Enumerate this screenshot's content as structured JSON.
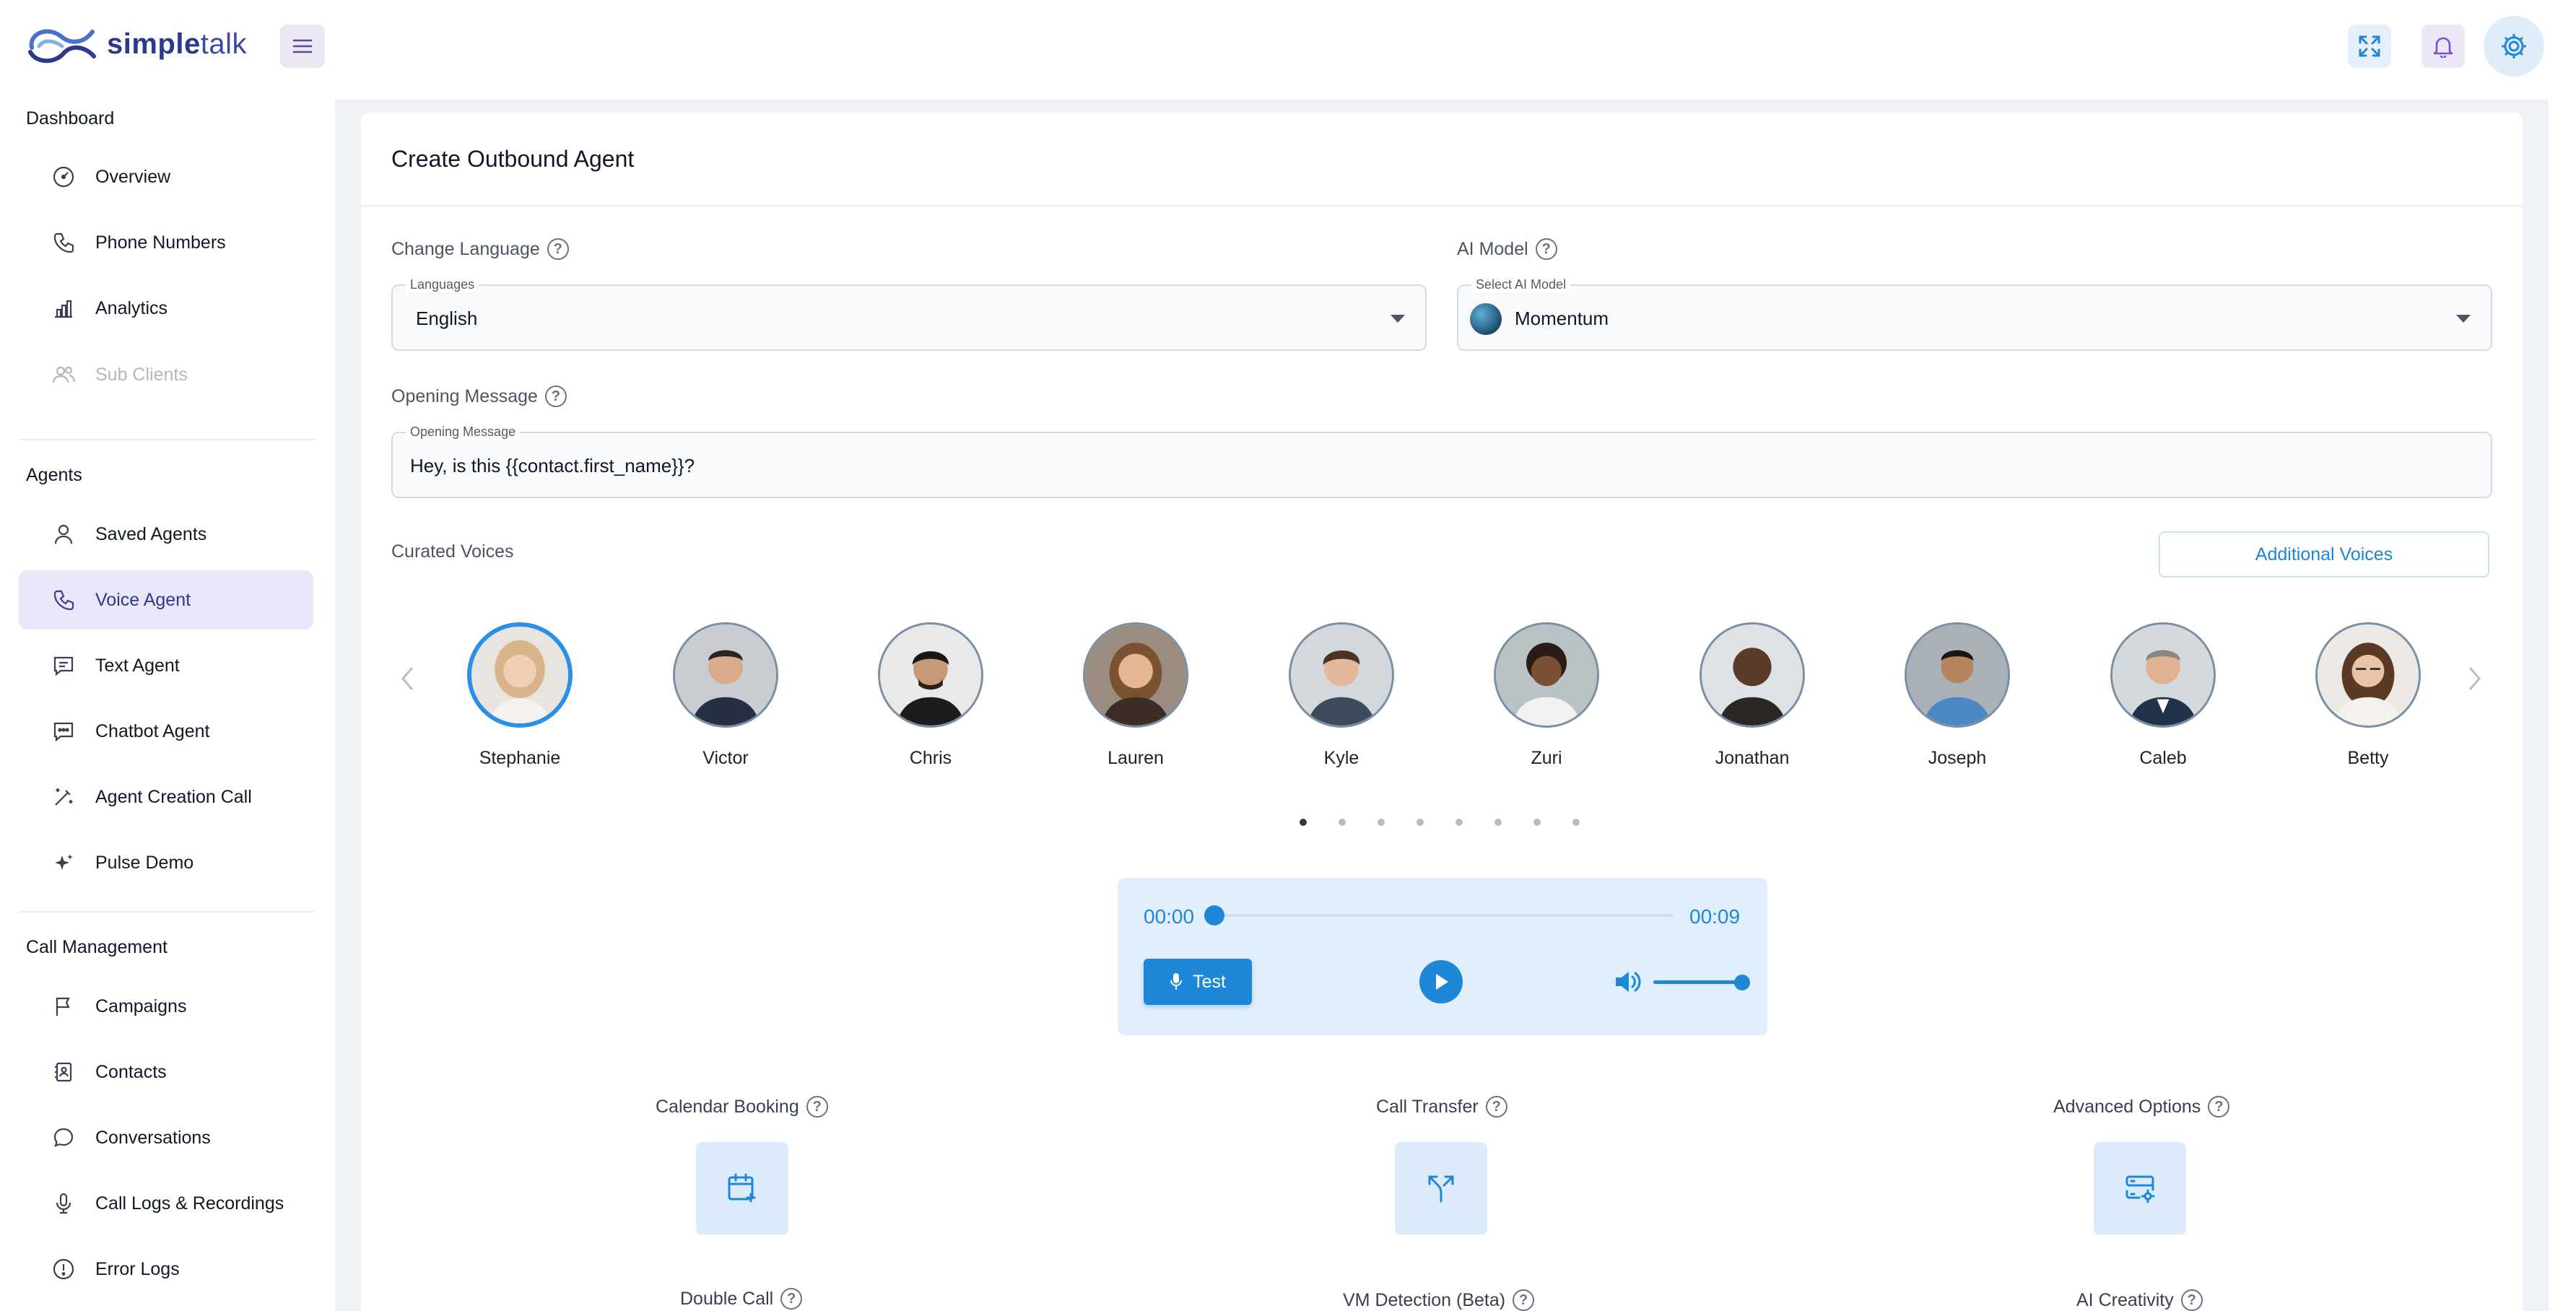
{
  "brand": {
    "name_bold": "simple",
    "name_light": "talk"
  },
  "topbar": {
    "menu_icon": "hamburger-icon",
    "fullscreen_icon": "expand-icon",
    "notifications_icon": "bell-icon",
    "settings_icon": "gear-icon"
  },
  "sidebar": {
    "sections": [
      {
        "title": "Dashboard",
        "items": [
          {
            "label": "Overview",
            "icon": "gauge-icon"
          },
          {
            "label": "Phone Numbers",
            "icon": "phone-icon"
          },
          {
            "label": "Analytics",
            "icon": "bar-chart-icon"
          },
          {
            "label": "Sub Clients",
            "icon": "users-icon",
            "disabled": true
          }
        ]
      },
      {
        "title": "Agents",
        "items": [
          {
            "label": "Saved Agents",
            "icon": "user-icon"
          },
          {
            "label": "Voice Agent",
            "icon": "phone-icon",
            "active": true
          },
          {
            "label": "Text Agent",
            "icon": "message-square-icon"
          },
          {
            "label": "Chatbot Agent",
            "icon": "chat-bubble-icon"
          },
          {
            "label": "Agent Creation Call",
            "icon": "magic-wand-icon"
          },
          {
            "label": "Pulse Demo",
            "icon": "sparkles-icon"
          }
        ]
      },
      {
        "title": "Call Management",
        "items": [
          {
            "label": "Campaigns",
            "icon": "flag-icon"
          },
          {
            "label": "Contacts",
            "icon": "contacts-book-icon"
          },
          {
            "label": "Conversations",
            "icon": "speech-bubble-icon"
          },
          {
            "label": "Call Logs & Recordings",
            "icon": "microphone-icon"
          },
          {
            "label": "Error Logs",
            "icon": "alert-circle-icon"
          }
        ]
      }
    ]
  },
  "page": {
    "title": "Create Outbound Agent",
    "language": {
      "label": "Change Language",
      "legend": "Languages",
      "value": "English"
    },
    "ai_model": {
      "label": "AI Model",
      "legend": "Select AI Model",
      "value": "Momentum"
    },
    "opening_message": {
      "label": "Opening Message",
      "legend": "Opening Message",
      "value": "Hey, is this {{contact.first_name}}?"
    },
    "curated_voices": {
      "label": "Curated Voices",
      "additional_button": "Additional Voices",
      "voices": [
        "Stephanie",
        "Victor",
        "Chris",
        "Lauren",
        "Kyle",
        "Zuri",
        "Jonathan",
        "Joseph",
        "Caleb",
        "Betty"
      ],
      "selected": "Stephanie",
      "page_count": 8,
      "current_page": 1
    },
    "player": {
      "current_time": "00:00",
      "duration": "00:09",
      "progress": 0,
      "volume": 1.0,
      "test_label": "Test"
    },
    "options": [
      {
        "label": "Calendar Booking",
        "icon": "calendar-plus-icon"
      },
      {
        "label": "Call Transfer",
        "icon": "split-arrows-icon"
      },
      {
        "label": "Advanced Options",
        "icon": "server-settings-icon"
      }
    ],
    "options_row2": [
      "Double Call",
      "VM Detection (Beta)",
      "AI Creativity"
    ]
  },
  "colors": {
    "accent": "#1e87d8",
    "brand": "#2b3a8c",
    "active_nav_bg": "#ebe6f7"
  }
}
